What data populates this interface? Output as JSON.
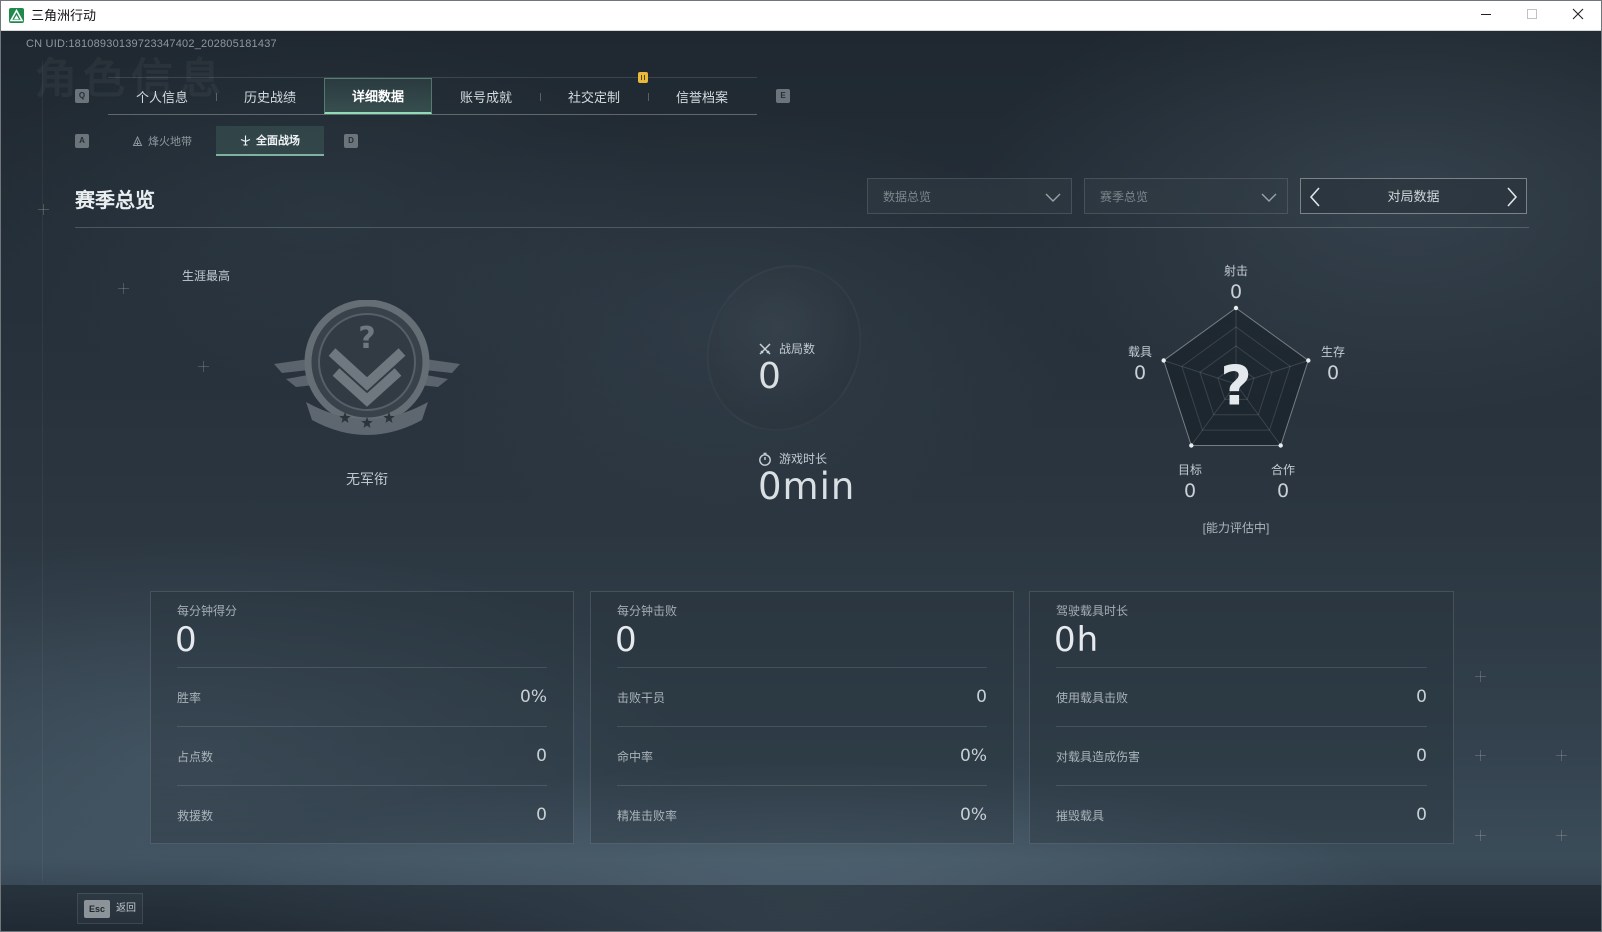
{
  "window": {
    "title": "三角洲行动",
    "app_icon": "delta-force-logo-icon",
    "minimize_icon": "minimize-icon",
    "maximize_icon": "maximize-icon",
    "close_icon": "close-icon"
  },
  "uid": "CN UID:18108930139723347402_202805181437",
  "watermark": "角色信息",
  "tabs": {
    "prev_key": "Q",
    "next_key": "E",
    "items": [
      "个人信息",
      "历史战绩",
      "详细数据",
      "账号成就",
      "社交定制",
      "信誉档案"
    ],
    "active_index": 2,
    "badge_index": 4
  },
  "subtabs": {
    "prev_key": "A",
    "next_key": "D",
    "items": [
      {
        "label": "烽火地带",
        "icon": "hazard-zone-icon"
      },
      {
        "label": "全面战场",
        "icon": "warfare-icon"
      }
    ],
    "active_index": 1
  },
  "section": {
    "title": "赛季总览"
  },
  "filters": {
    "data_scope": {
      "value": "数据总览",
      "icon": "chevron-down-icon"
    },
    "season": {
      "value": "赛季总览",
      "icon": "chevron-down-icon"
    },
    "view_mode": {
      "value": "对局数据",
      "prev_icon": "chevron-left-icon",
      "next_icon": "chevron-right-icon"
    }
  },
  "rank": {
    "label": "生涯最高",
    "emblem_icon": "rank-emblem-icon",
    "emblem_symbol": "?",
    "name": "无军衔"
  },
  "overview": {
    "matches": {
      "label": "战局数",
      "value": "0",
      "icon": "crossed-swords-icon"
    },
    "playtime": {
      "label": "游戏时长",
      "value": "0min",
      "icon": "stopwatch-icon"
    }
  },
  "radar": {
    "axes": [
      {
        "label": "射击",
        "value": 0
      },
      {
        "label": "生存",
        "value": 0
      },
      {
        "label": "合作",
        "value": 0
      },
      {
        "label": "目标",
        "value": 0
      },
      {
        "label": "载具",
        "value": 0
      }
    ],
    "center_symbol": "?",
    "status": "[能力评估中]"
  },
  "cards": [
    {
      "title": "每分钟得分",
      "value": "0",
      "rows": [
        {
          "label": "胜率",
          "value": "0%"
        },
        {
          "label": "占点数",
          "value": "0"
        },
        {
          "label": "救援数",
          "value": "0"
        }
      ]
    },
    {
      "title": "每分钟击败",
      "value": "0",
      "rows": [
        {
          "label": "击败干员",
          "value": "0"
        },
        {
          "label": "命中率",
          "value": "0%"
        },
        {
          "label": "精准击败率",
          "value": "0%"
        }
      ]
    },
    {
      "title": "驾驶载具时长",
      "value": "0h",
      "rows": [
        {
          "label": "使用载具击败",
          "value": "0"
        },
        {
          "label": "对载具造成伤害",
          "value": "0"
        },
        {
          "label": "摧毁载具",
          "value": "0"
        }
      ]
    }
  ],
  "footer": {
    "key": "Esc",
    "label": "返回"
  },
  "colors": {
    "accent": "#8fdcb6",
    "text_primary": "#e6ebef",
    "text_secondary": "#9aa4ab",
    "badge": "#e8b93a",
    "background": "#27323c"
  }
}
